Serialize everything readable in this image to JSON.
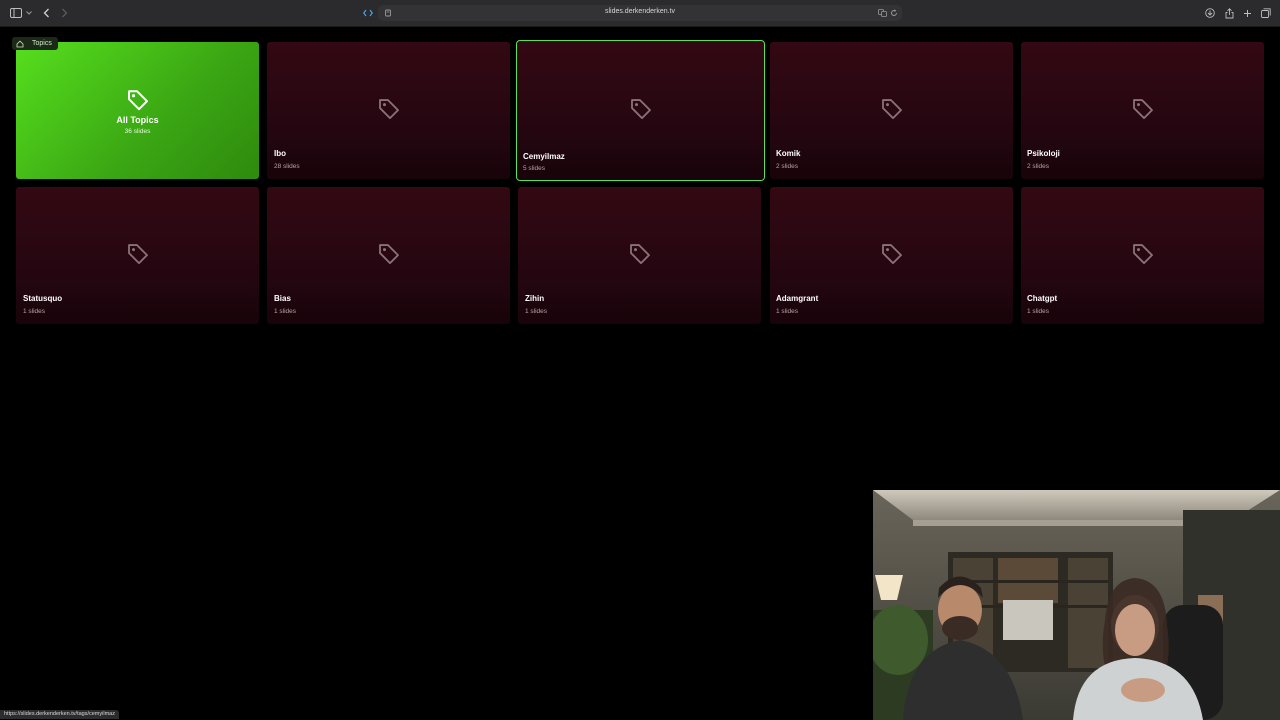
{
  "browser": {
    "url": "slides.derkenderken.tv",
    "status_url": "https://slides.derkenderken.tv/tags/cemyilmaz"
  },
  "breadcrumb": {
    "label": "Topics"
  },
  "all_topics": {
    "title": "All Topics",
    "count": "36 slides"
  },
  "topics": [
    {
      "title": "Ibo",
      "count": "28 slides"
    },
    {
      "title": "Cemyilmaz",
      "count": "5 slides"
    },
    {
      "title": "Komik",
      "count": "2 slides"
    },
    {
      "title": "Psikoloji",
      "count": "2 slides"
    },
    {
      "title": "Statusquo",
      "count": "1 slides"
    },
    {
      "title": "Bias",
      "count": "1 slides"
    },
    {
      "title": "Zihin",
      "count": "1 slides"
    },
    {
      "title": "Adamgrant",
      "count": "1 slides"
    },
    {
      "title": "Chatgpt",
      "count": "1 slides"
    }
  ],
  "colors": {
    "accent_green": "#4cc41a",
    "card_bg": "#2a0710",
    "selected_outline": "#5ee05a"
  }
}
